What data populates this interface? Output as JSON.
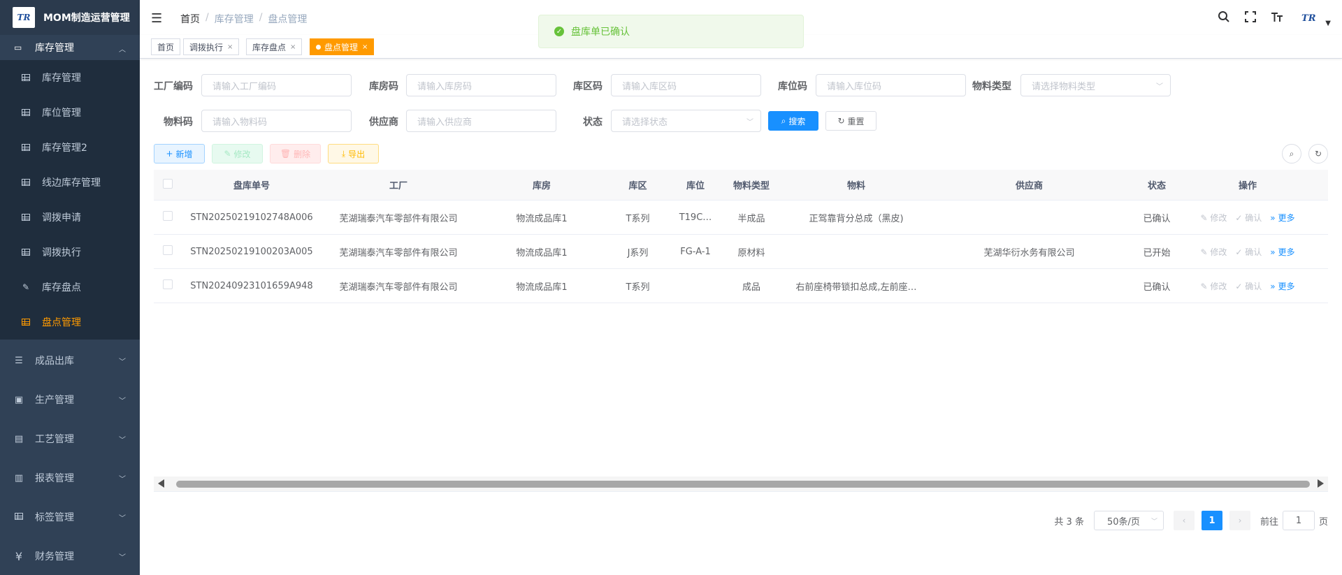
{
  "brand": {
    "logo": "TR",
    "title": "MOM制造运营管理"
  },
  "sidebar": {
    "open_group": {
      "label": "库存管理",
      "icon": "monitor-icon"
    },
    "sub_items": [
      {
        "label": "库存管理",
        "icon": "table-icon"
      },
      {
        "label": "库位管理",
        "icon": "table-icon"
      },
      {
        "label": "库存管理2",
        "icon": "table-icon"
      },
      {
        "label": "线边库存管理",
        "icon": "table-icon"
      },
      {
        "label": "调拨申请",
        "icon": "table-icon"
      },
      {
        "label": "调拨执行",
        "icon": "table-icon"
      },
      {
        "label": "库存盘点",
        "icon": "edit-icon"
      },
      {
        "label": "盘点管理",
        "icon": "table-icon",
        "active": true
      }
    ],
    "groups": [
      {
        "label": "成品出库",
        "icon": "list-icon"
      },
      {
        "label": "生产管理",
        "icon": "monitor-icon"
      },
      {
        "label": "工艺管理",
        "icon": "tool-icon"
      },
      {
        "label": "报表管理",
        "icon": "report-icon"
      },
      {
        "label": "标签管理",
        "icon": "table-icon"
      },
      {
        "label": "财务管理",
        "icon": "yen-icon"
      }
    ]
  },
  "header": {
    "breadcrumb": [
      "首页",
      "库存管理",
      "盘点管理"
    ],
    "avatar": "TR"
  },
  "tags": [
    {
      "label": "首页",
      "closable": false
    },
    {
      "label": "调拨执行",
      "closable": true
    },
    {
      "label": "库存盘点",
      "closable": true
    },
    {
      "label": "盘点管理",
      "closable": true,
      "active": true
    }
  ],
  "toast": {
    "message": "盘库单已确认",
    "type": "success"
  },
  "search": {
    "factory_label": "工厂编码",
    "factory_placeholder": "请输入工厂编码",
    "warehouse_label": "库房码",
    "warehouse_placeholder": "请输入库房码",
    "area_label": "库区码",
    "area_placeholder": "请输入库区码",
    "location_label": "库位码",
    "location_placeholder": "请输入库位码",
    "material_type_label": "物料类型",
    "material_type_placeholder": "请选择物料类型",
    "material_label": "物料码",
    "material_placeholder": "请输入物料码",
    "supplier_label": "供应商",
    "supplier_placeholder": "请输入供应商",
    "status_label": "状态",
    "status_placeholder": "请选择状态",
    "search_btn": "搜索",
    "reset_btn": "重置"
  },
  "toolbar": {
    "add": "新增",
    "edit": "修改",
    "delete": "删除",
    "export": "导出"
  },
  "table": {
    "columns": [
      "盘库单号",
      "工厂",
      "库房",
      "库区",
      "库位",
      "物料类型",
      "物料",
      "供应商",
      "状态",
      "操作"
    ],
    "rows": [
      {
        "id": "STN20250219102748A006",
        "factory": "芜湖瑞泰汽车零部件有限公司",
        "warehouse": "物流成品库1",
        "area": "T系列",
        "location": "T19C…",
        "material_type": "半成品",
        "material": "正驾靠背分总成（黑皮)",
        "supplier": "",
        "status": "已确认"
      },
      {
        "id": "STN20250219100203A005",
        "factory": "芜湖瑞泰汽车零部件有限公司",
        "warehouse": "物流成品库1",
        "area": "J系列",
        "location": "FG-A-1",
        "material_type": "原材料",
        "material": "",
        "supplier": "芜湖华衍水务有限公司",
        "status": "已开始"
      },
      {
        "id": "STN20240923101659A948",
        "factory": "芜湖瑞泰汽车零部件有限公司",
        "warehouse": "物流成品库1",
        "area": "T系列",
        "location": "",
        "material_type": "成品",
        "material": "右前座椅带锁扣总成,左前座…",
        "supplier": "",
        "status": "已确认"
      }
    ],
    "ops": {
      "edit": "修改",
      "confirm": "确认",
      "more": "更多"
    }
  },
  "pagination": {
    "total": "共 3 条",
    "page_size": "50条/页",
    "current": "1",
    "goto_prefix": "前往",
    "goto_value": "1",
    "goto_suffix": "页"
  }
}
